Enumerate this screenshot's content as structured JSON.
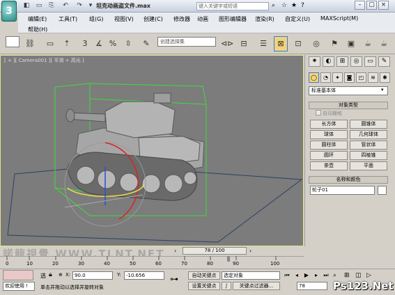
{
  "titlebar": {
    "title": "坦克动画盗文件.max",
    "search_placeholder": "键入关键字或短语",
    "quick_access": [
      "◧",
      "▭",
      "⎘",
      "↶",
      "↷",
      "▾"
    ]
  },
  "menu": {
    "row1": [
      "编辑(E)",
      "工具(T)",
      "组(G)",
      "视图(V)",
      "创建(C)",
      "修改器",
      "动画",
      "图形编辑器",
      "渲染(R)",
      "自定义(U)",
      "MAXScript(M)"
    ],
    "row2": [
      "帮助(H)"
    ]
  },
  "toolbar": {
    "selection_set_placeholder": "创建选择集"
  },
  "viewport": {
    "label": "[ + ][ Camera001 ][ 平滑 + 高光 ]"
  },
  "panel": {
    "primitive_type": "标准基本体",
    "object_type_title": "对象类型",
    "autogrid_label": "自动栅格",
    "object_buttons": [
      "长方体",
      "圆锥体",
      "球体",
      "几何球体",
      "圆柱体",
      "管状体",
      "圆环",
      "四棱锥",
      "茶壶",
      "平面"
    ],
    "name_color_title": "名称和颜色",
    "object_name": "轮子01"
  },
  "timeline": {
    "frame_indicator": "78 / 100",
    "ticks": [
      "0",
      "10",
      "20",
      "30",
      "40",
      "50",
      "60",
      "70",
      "80",
      "90",
      "100"
    ]
  },
  "status": {
    "welcome": "欢迎使用 !",
    "selection_label": "选",
    "x_label": "X:",
    "x_value": "90.0",
    "y_label": "Y:",
    "y_value": "-10.656",
    "auto_key": "自动关键点",
    "set_key": "设置关键点",
    "selected_object": "选定对象",
    "key_filters": "关键点过滤器...",
    "prompt": "单击并拖动以选择并旋转对象",
    "current_frame": "78"
  },
  "watermarks": {
    "left": "諾龍視覺 WWW.TLNT.NET",
    "right": "Ps123.Net"
  },
  "colors": {
    "viewport_bg": "#7c7c7c",
    "bbox_green": "#3ddc3d",
    "selection_yellow": "#f0e04a"
  }
}
